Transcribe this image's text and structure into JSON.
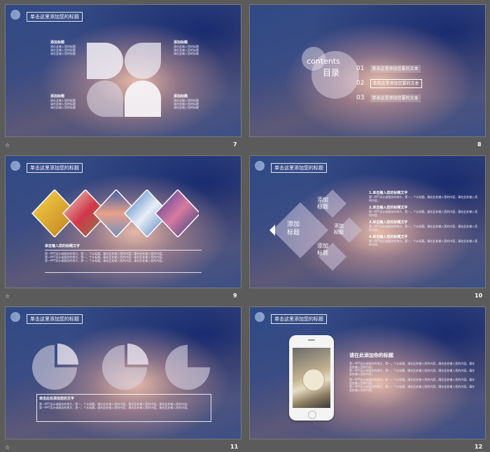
{
  "slides": [
    {
      "number": "7",
      "title": "单击这里添加您的标题",
      "left_top_label": "添加标题",
      "left_bottom_label": "添加标题",
      "right_top_label": "添加标题",
      "right_bottom_label": "添加标题",
      "filler_line": "请在此输入您的标题"
    },
    {
      "number": "8",
      "contents_en": "contents",
      "contents_cn": "目录",
      "items": [
        {
          "num": "01",
          "text": "单击这里添加您要的文本"
        },
        {
          "num": "02",
          "text": "单击这里添加您要的文本"
        },
        {
          "num": "03",
          "text": "单击这里添加您要的文本"
        }
      ]
    },
    {
      "number": "9",
      "title": "单击这里添加您的标题",
      "caption_title": "单击输入您的标题文字",
      "body_line": "第一PPT设计或服务的地方，第一，个从标题。填在此处输入您的内容，填在此处输入您的内容。"
    },
    {
      "number": "10",
      "title": "单击这里添加您的标题",
      "diamond_main": "添加\n标题",
      "diamond_top": "添加\n标题",
      "diamond_right": "添加\n标题",
      "diamond_bottom": "添加\n标题",
      "list": [
        {
          "head": "1.单击输入您的标题文字",
          "body": "第一PPT设计或服务的地方，第一，个从标题。填在此处输入您的内容，填在此处输入您的内容。"
        },
        {
          "head": "2.单击输入您的标题文字",
          "body": "第一PPT设计或服务的地方，第一，个从标题。填在此处输入您的内容，填在此处输入您的内容。"
        },
        {
          "head": "3.单击输入您的标题文字",
          "body": "第一PPT设计或服务的地方，第一，个从标题。填在此处输入您的内容，填在此处输入您的内容。"
        },
        {
          "head": "4.单击输入您的标题文字",
          "body": "第一PPT设计或服务的地方，第一，个从标题。填在此处输入您的内容，填在此处输入您的内容。"
        }
      ]
    },
    {
      "number": "11",
      "title": "单击这里添加您的标题",
      "box_title": "单击此处添加您的文字",
      "box_body": "第一PPT设计或服务的地方，第一，个从标题。填在此处输入您的内容，填在此处输入您的内容。填在此处输入您的内容。"
    },
    {
      "number": "12",
      "title": "单击这里添加您的标题",
      "heading": "请在此添加你的标题",
      "body": "第一PPT设计或服务的地方，第一，个从标题。填在此处输入您的内容，填在此处输入您的内容。填在此处输入您的内容。"
    }
  ],
  "footer_symbol": "☆"
}
